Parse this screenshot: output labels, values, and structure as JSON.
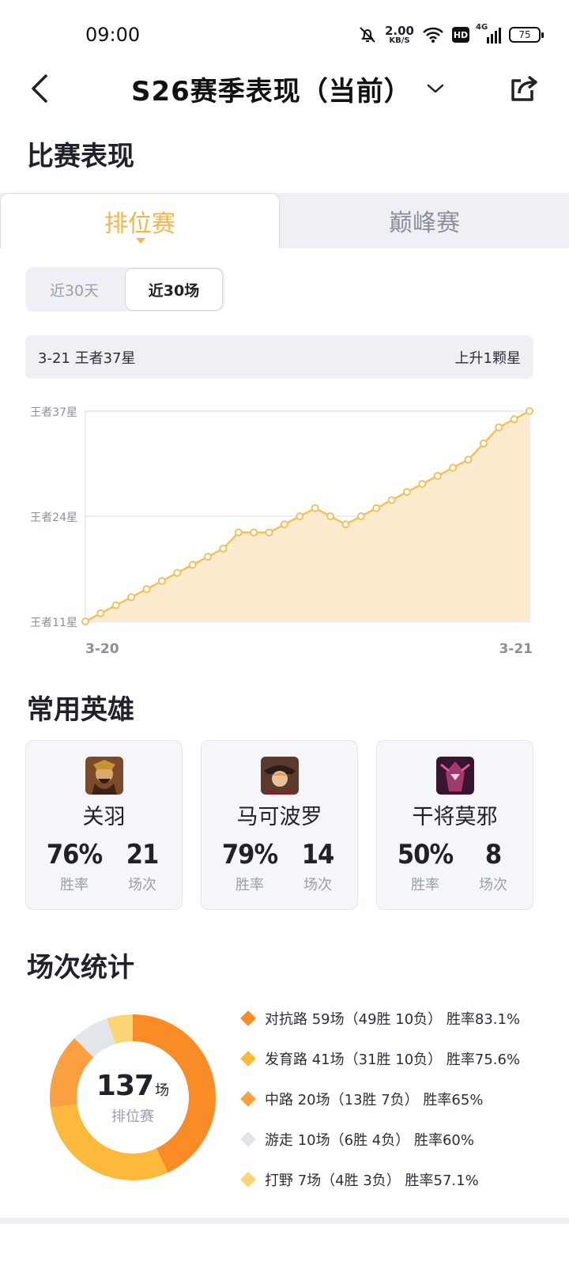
{
  "status_bar": {
    "time": "09:00",
    "speed_value": "2.00",
    "speed_unit": "KB/S",
    "hd": "HD",
    "network": "4G",
    "battery": "75"
  },
  "header": {
    "title": "S26赛季表现（当前）"
  },
  "match_section": {
    "title": "比赛表现",
    "tabs": [
      {
        "label": "排位赛",
        "active": true
      },
      {
        "label": "巅峰赛",
        "active": false
      }
    ],
    "segments": [
      {
        "label": "近30天",
        "selected": false
      },
      {
        "label": "近30场",
        "selected": true
      }
    ],
    "info": {
      "left": "3-21 王者37星",
      "right": "上升1颗星"
    }
  },
  "chart_data": {
    "type": "area",
    "ytick_labels": [
      "王者11星",
      "王者24星",
      "王者37星"
    ],
    "ylim": [
      11,
      37
    ],
    "xtick_labels": [
      "3-20",
      "3-21"
    ],
    "values": [
      11,
      12,
      13,
      14,
      15,
      16,
      17,
      18,
      19,
      20,
      22,
      22,
      22,
      23,
      24,
      25,
      24,
      23,
      24,
      25,
      26,
      27,
      28,
      29,
      30,
      31,
      33,
      35,
      36,
      37
    ],
    "color": "#f3c15c",
    "fill": "#fdebcf",
    "grid": true
  },
  "heroes_section": {
    "title": "常用英雄",
    "heroes": [
      {
        "name": "关羽",
        "win_rate": "76%",
        "win_rate_label": "胜率",
        "games": "21",
        "games_label": "场次"
      },
      {
        "name": "马可波罗",
        "win_rate": "79%",
        "win_rate_label": "胜率",
        "games": "14",
        "games_label": "场次"
      },
      {
        "name": "干将莫邪",
        "win_rate": "50%",
        "win_rate_label": "胜率",
        "games": "8",
        "games_label": "场次"
      }
    ]
  },
  "stats_section": {
    "title": "场次统计",
    "total": "137",
    "total_unit": "场",
    "total_label": "排位赛",
    "legend": [
      {
        "text": "对抗路 59场（49胜 10负） 胜率83.1%",
        "games": 59,
        "color": "#f98c26"
      },
      {
        "text": "发育路 41场（31胜 10负） 胜率75.6%",
        "games": 41,
        "color": "#fcb93c"
      },
      {
        "text": "中路 20场（13胜 7负） 胜率65%",
        "games": 20,
        "color": "#fba040"
      },
      {
        "text": "游走 10场（6胜 4负） 胜率60%",
        "games": 10,
        "color": "#e2e5ea"
      },
      {
        "text": "打野 7场（4胜 3负） 胜率57.1%",
        "games": 7,
        "color": "#fdd574"
      }
    ]
  }
}
